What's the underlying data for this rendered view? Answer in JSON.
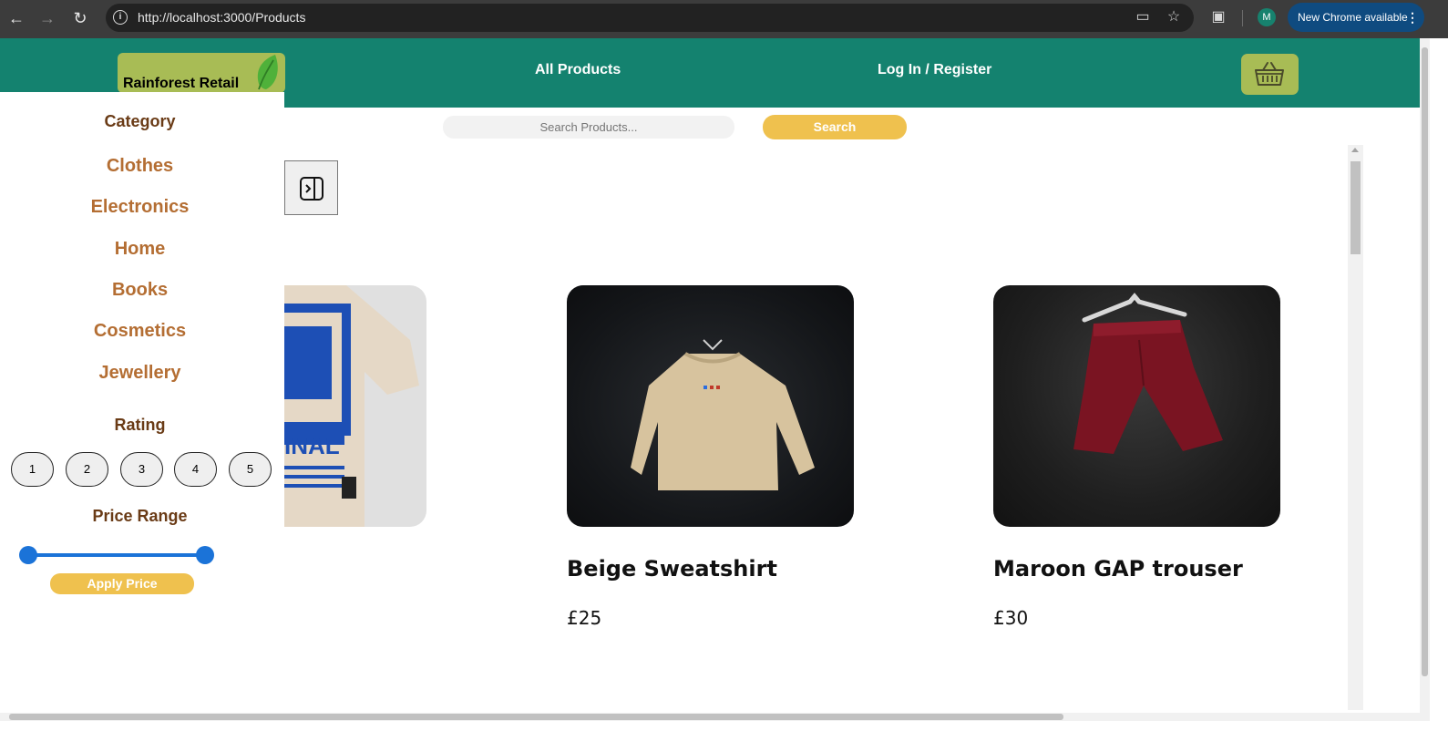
{
  "browser": {
    "url": "http://localhost:3000/Products",
    "update_label": "New Chrome available",
    "profile_initial": "M",
    "icons": [
      "back-icon",
      "forward-icon",
      "reload-icon",
      "info-icon",
      "install-icon",
      "star-icon",
      "extensions-icon",
      "menu-icon"
    ]
  },
  "header": {
    "logo_text": "Rainforest Retail",
    "nav": {
      "all_products": "All Products",
      "login": "Log In / Register"
    },
    "colors": {
      "header_bg": "#14826f",
      "logo_bg": "#a8bc55"
    }
  },
  "sidebar": {
    "category_heading": "Category",
    "categories": [
      "Clothes",
      "Electronics",
      "Home",
      "Books",
      "Cosmetics",
      "Jewellery"
    ],
    "rating_heading": "Rating",
    "ratings": [
      "1",
      "2",
      "3",
      "4",
      "5"
    ],
    "price_heading": "Price Range",
    "apply_label": "Apply Price",
    "price_slider": {
      "min_fraction": 0.0,
      "max_fraction": 1.0
    }
  },
  "search": {
    "placeholder": "Search Products...",
    "button_label": "Search"
  },
  "products": [
    {
      "name": "",
      "price": "",
      "image": "t-shirt"
    },
    {
      "name": "Beige Sweatshirt",
      "price": "£25",
      "image": "sweatshirt"
    },
    {
      "name": "Maroon GAP trouser",
      "price": "£30",
      "image": "trouser"
    }
  ],
  "colors": {
    "accent": "#efc14e",
    "category_text": "#b46e33",
    "heading_text": "#6a3b16",
    "slider": "#1b73d8"
  }
}
